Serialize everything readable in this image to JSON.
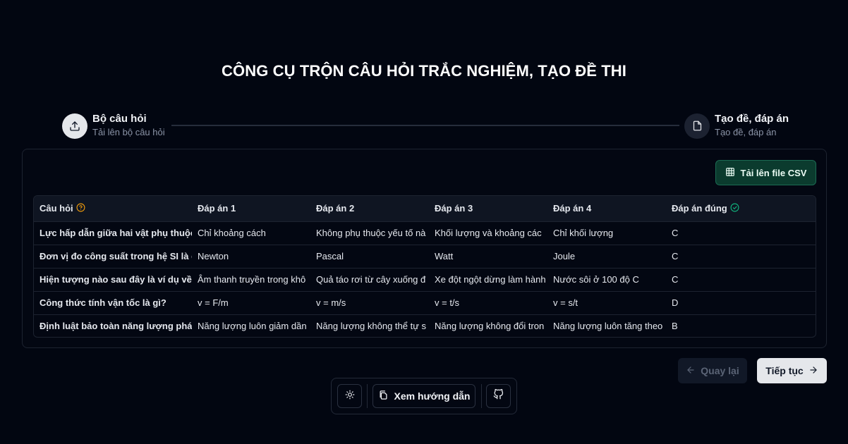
{
  "page": {
    "title": "CÔNG CỤ TRỘN CÂU HỎI TRẮC NGHIỆM, TẠO ĐỀ THI"
  },
  "stepper": {
    "steps": [
      {
        "title": "Bộ câu hỏi",
        "subtitle": "Tải lên bộ câu hỏi",
        "icon": "upload-icon",
        "active": true
      },
      {
        "title": "Tạo đề, đáp án",
        "subtitle": "Tạo đề, đáp án",
        "icon": "file-icon",
        "active": false
      }
    ]
  },
  "upload_button": {
    "label": "Tải lên file CSV",
    "icon": "table-icon"
  },
  "table": {
    "headers": [
      "Câu hỏi",
      "Đáp án 1",
      "Đáp án 2",
      "Đáp án 3",
      "Đáp án 4",
      "Đáp án đúng"
    ],
    "rows": [
      [
        "Lực hấp dẫn giữa hai vật phụ thuộc",
        "Chỉ khoảng cách",
        "Không phụ thuộc yếu tố nà",
        "Khối lượng và khoảng các",
        "Chỉ khối lượng",
        "C"
      ],
      [
        "Đơn vị đo công suất trong hệ SI là g",
        "Newton",
        "Pascal",
        "Watt",
        "Joule",
        "C"
      ],
      [
        "Hiện tượng nào sau đây là ví dụ về c",
        "Âm thanh truyền trong khô",
        "Quả táo rơi từ cây xuống đ",
        "Xe đột ngột dừng làm hành",
        "Nước sôi ở 100 độ C",
        "C"
      ],
      [
        "Công thức tính vận tốc là gì?",
        "v = F/m",
        "v = m/s",
        "v = t/s",
        "v = s/t",
        "D"
      ],
      [
        "Định luật bảo toàn năng lượng phát",
        "Năng lượng luôn giảm dần",
        "Năng lượng không thể tự s",
        "Năng lượng không đổi tron",
        "Năng lượng luôn tăng theo",
        "B"
      ]
    ]
  },
  "navigation": {
    "back_label": "Quay lại",
    "next_label": "Tiếp tục"
  },
  "toolbar": {
    "guide_label": "Xem hướng dẫn"
  },
  "colors": {
    "background": "#020611",
    "accent_green": "#0b3b2e",
    "help_orange": "#f59e0b",
    "check_green": "#10b981"
  }
}
